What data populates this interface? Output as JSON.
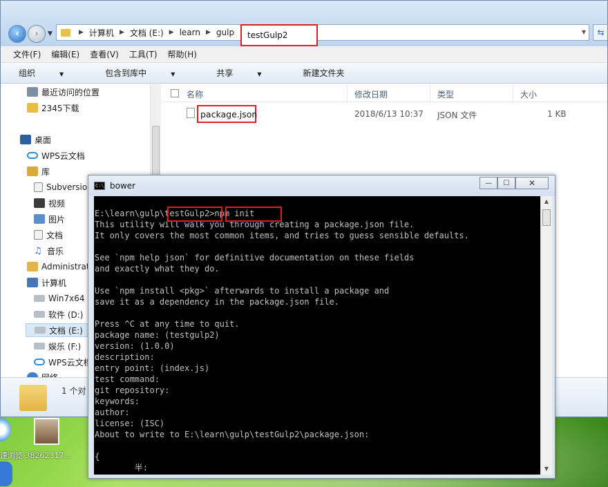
{
  "address": {
    "crumbs": [
      "计算机",
      "文档 (E:)",
      "learn",
      "gulp"
    ],
    "current": "testGulp2",
    "refresh_icon": "refresh-icon"
  },
  "menu": [
    "文件(F)",
    "编辑(E)",
    "查看(V)",
    "工具(T)",
    "帮助(H)"
  ],
  "toolbar": {
    "organize": "组织",
    "include": "包含到库中",
    "share": "共享",
    "new_folder": "新建文件夹"
  },
  "nav": [
    {
      "label": "最近访问的位置",
      "icon": "recent-icon"
    },
    {
      "label": "2345下载",
      "icon": "folder-icon"
    },
    {
      "label": "桌面",
      "icon": "desktop-icon"
    },
    {
      "label": "WPS云文档",
      "icon": "cloud-icon"
    },
    {
      "label": "库",
      "icon": "library-icon"
    },
    {
      "label": "Subversio",
      "icon": "document-icon"
    },
    {
      "label": "视频",
      "icon": "video-icon"
    },
    {
      "label": "图片",
      "icon": "picture-icon"
    },
    {
      "label": "文档",
      "icon": "document-icon"
    },
    {
      "label": "音乐",
      "icon": "music-icon"
    },
    {
      "label": "Administrat",
      "icon": "user-folder-icon"
    },
    {
      "label": "计算机",
      "icon": "computer-icon"
    },
    {
      "label": "Win7x64 (",
      "icon": "drive-icon"
    },
    {
      "label": "软件 (D:)",
      "icon": "drive-icon"
    },
    {
      "label": "文档 (E:)",
      "icon": "drive-icon"
    },
    {
      "label": "娱乐 (F:)",
      "icon": "drive-icon"
    },
    {
      "label": "WPS云文档",
      "icon": "cloud-icon"
    },
    {
      "label": "网络",
      "icon": "network-icon"
    }
  ],
  "columns": {
    "name": "名称",
    "modified": "修改日期",
    "type": "类型",
    "size": "大小"
  },
  "files": [
    {
      "name": "package.json",
      "modified": "2018/6/13 10:37",
      "type": "JSON 文件",
      "size": "1 KB"
    }
  ],
  "status": {
    "count": "1 个对"
  },
  "desktop": {
    "caption": "速浏览 38262317..."
  },
  "console": {
    "title": "bower",
    "title_icon": "C:\\",
    "lines": [
      "E:\\learn\\gulp\\testGulp2>npm init",
      "This utility will walk you through creating a package.json file.",
      "It only covers the most common items, and tries to guess sensible defaults.",
      "",
      "See `npm help json` for definitive documentation on these fields",
      "and exactly what they do.",
      "",
      "Use `npm install <pkg>` afterwards to install a package and",
      "save it as a dependency in the package.json file.",
      "",
      "Press ^C at any time to quit.",
      "package name: (testgulp2)",
      "version: (1.0.0)",
      "description:",
      "entry point: (index.js)",
      "test command:",
      "git repository:",
      "keywords:",
      "author:",
      "license: (ISC)",
      "About to write to E:\\learn\\gulp\\testGulp2\\package.json:",
      "",
      "{",
      "        半:"
    ]
  }
}
